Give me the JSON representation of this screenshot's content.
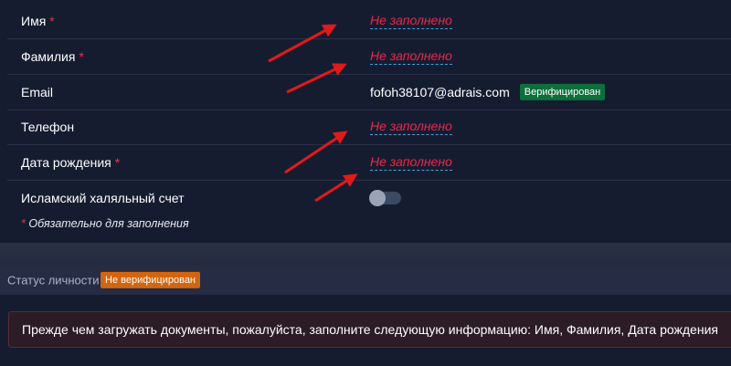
{
  "form": {
    "fields": [
      {
        "label": "Имя",
        "required": "*",
        "value": "Не заполнено"
      },
      {
        "label": "Фамилия",
        "required": "*",
        "value": "Не заполнено"
      },
      {
        "label": "Email",
        "value": "fofoh38107@adrais.com",
        "badge": "Верифицирован"
      },
      {
        "label": "Телефон",
        "value": "Не заполнено"
      },
      {
        "label": "Дата рождения",
        "required": "*",
        "value": "Не заполнено"
      },
      {
        "label": "Исламский халяльный счет",
        "toggle_on": false
      }
    ],
    "required_note_star": "*",
    "required_note": "Обязательно для заполнения"
  },
  "status": {
    "label": "Статус личности",
    "badge": "Не верифицирован"
  },
  "alert": {
    "text": "Прежде чем загружать документы, пожалуйста, заполните следующую информацию: Имя, Фамилия, Дата рождения"
  },
  "colors": {
    "background": "#161c30",
    "required_red": "#e8284c",
    "verified_green": "#0e6e3c",
    "unverified_orange": "#d4650f",
    "arrow_red": "#e01a1a"
  }
}
